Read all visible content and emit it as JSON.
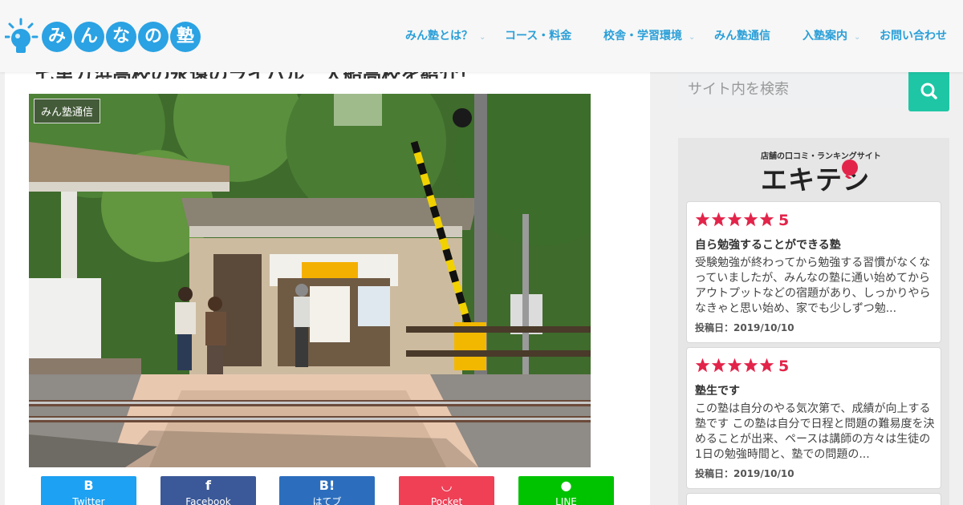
{
  "header": {
    "logo_chars": [
      "み",
      "ん",
      "な",
      "の",
      "塾"
    ],
    "nav": [
      {
        "label": "みん塾とは？",
        "has_dropdown": true
      },
      {
        "label": "コース・料金",
        "has_dropdown": false
      },
      {
        "label": "校舎・学習環境",
        "has_dropdown": true
      },
      {
        "label": "みん塾通信",
        "has_dropdown": false
      },
      {
        "label": "入塾案内",
        "has_dropdown": true
      },
      {
        "label": "お問い合わせ",
        "has_dropdown": false
      }
    ]
  },
  "article": {
    "title": "七里ガ浜高校の永遠のライバル　大船高校を紹介！",
    "category_badge": "みん塾通信",
    "hero_image_icon": "railway-station-photo"
  },
  "share": [
    {
      "label": "Twitter",
      "icon": "B",
      "color": "#1da1f2",
      "icon_name": "twitter-icon"
    },
    {
      "label": "Facebook",
      "icon": "f",
      "color": "#3b5998",
      "icon_name": "facebook-icon"
    },
    {
      "label": "はてブ",
      "icon": "B!",
      "color": "#2c6ebd",
      "icon_name": "hatena-icon"
    },
    {
      "label": "Pocket",
      "icon": "◡",
      "color": "#ef4056",
      "icon_name": "pocket-icon"
    },
    {
      "label": "LINE",
      "icon": "●",
      "color": "#00c300",
      "icon_name": "line-icon"
    }
  ],
  "sidebar": {
    "search_placeholder": "サイト内を検索",
    "ekiten": {
      "subtitle": "店舗の口コミ・ランキングサイト",
      "logo": "エキテン"
    },
    "reviews": [
      {
        "score": "5",
        "stars": 5,
        "title": "自ら勉強することができる塾",
        "body": "受験勉強が終わってから勉強する習慣がなくなっていましたが、みんなの塾に通い始めてからアウトプットなどの宿題があり、しっかりやらなきゃと思い始め、家でも少しずつ勉...",
        "date": "投稿日：2019/10/10"
      },
      {
        "score": "5",
        "stars": 5,
        "title": "塾生です",
        "body": "この塾は自分のやる気次第で、成績が向上する塾です この塾は自分で日程と問題の難易度を決めることが出来、ペースは講師の方々は生徒の1日の勉強時間と、塾での問題の...",
        "date": "投稿日：2019/10/10"
      }
    ]
  },
  "colors": {
    "nav_accent": "#2a9fd8",
    "search_button": "#1ec6a5",
    "star": "#e3244a"
  }
}
